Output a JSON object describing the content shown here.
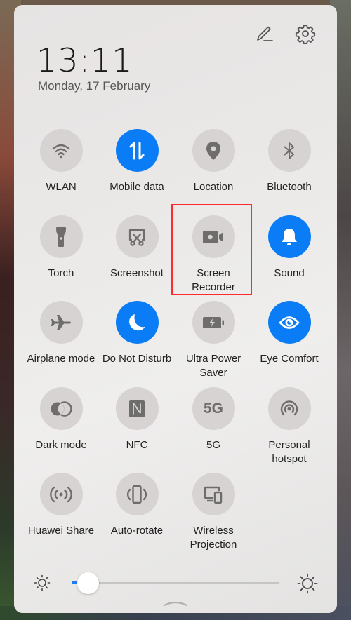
{
  "panel": {
    "time": "13:11",
    "date": "Monday, 17 February",
    "header_icons": [
      "edit-icon",
      "settings-icon"
    ]
  },
  "tiles": [
    {
      "label": "WLAN",
      "icon": "wifi-icon",
      "active": false
    },
    {
      "label": "Mobile data",
      "icon": "mobile-data-icon",
      "active": true
    },
    {
      "label": "Location",
      "icon": "location-pin-icon",
      "active": false
    },
    {
      "label": "Bluetooth",
      "icon": "bluetooth-icon",
      "active": false
    },
    {
      "label": "Torch",
      "icon": "flashlight-icon",
      "active": false
    },
    {
      "label": "Screenshot",
      "icon": "screenshot-scissors-icon",
      "active": false
    },
    {
      "label": "Screen\nRecorder",
      "icon": "video-camera-icon",
      "active": false,
      "highlighted": true
    },
    {
      "label": "Sound",
      "icon": "bell-icon",
      "active": true
    },
    {
      "label": "Airplane mode",
      "icon": "airplane-icon",
      "active": false
    },
    {
      "label": "Do Not Disturb",
      "icon": "moon-icon",
      "active": true
    },
    {
      "label": "Ultra Power\nSaver",
      "icon": "battery-bolt-icon",
      "active": false
    },
    {
      "label": "Eye Comfort",
      "icon": "eye-icon",
      "active": true
    },
    {
      "label": "Dark mode",
      "icon": "dark-mode-icon",
      "active": false
    },
    {
      "label": "NFC",
      "icon": "nfc-icon",
      "active": false
    },
    {
      "label": "5G",
      "icon": "5g-icon",
      "icon_text": "5G",
      "active": false
    },
    {
      "label": "Personal\nhotspot",
      "icon": "hotspot-icon",
      "active": false
    },
    {
      "label": "Huawei Share",
      "icon": "share-broadcast-icon",
      "active": false
    },
    {
      "label": "Auto-rotate",
      "icon": "auto-rotate-icon",
      "active": false
    },
    {
      "label": "Wireless\nProjection",
      "icon": "projection-icon",
      "active": false
    }
  ],
  "brightness": {
    "level_percent": 8,
    "min_icon": "brightness-low-icon",
    "max_icon": "brightness-high-icon"
  },
  "colors": {
    "accent": "#0a7cf5",
    "tile_off": "#d6d3d2",
    "icon_off": "#6f6d6c",
    "highlight": "#ff2a2a"
  }
}
